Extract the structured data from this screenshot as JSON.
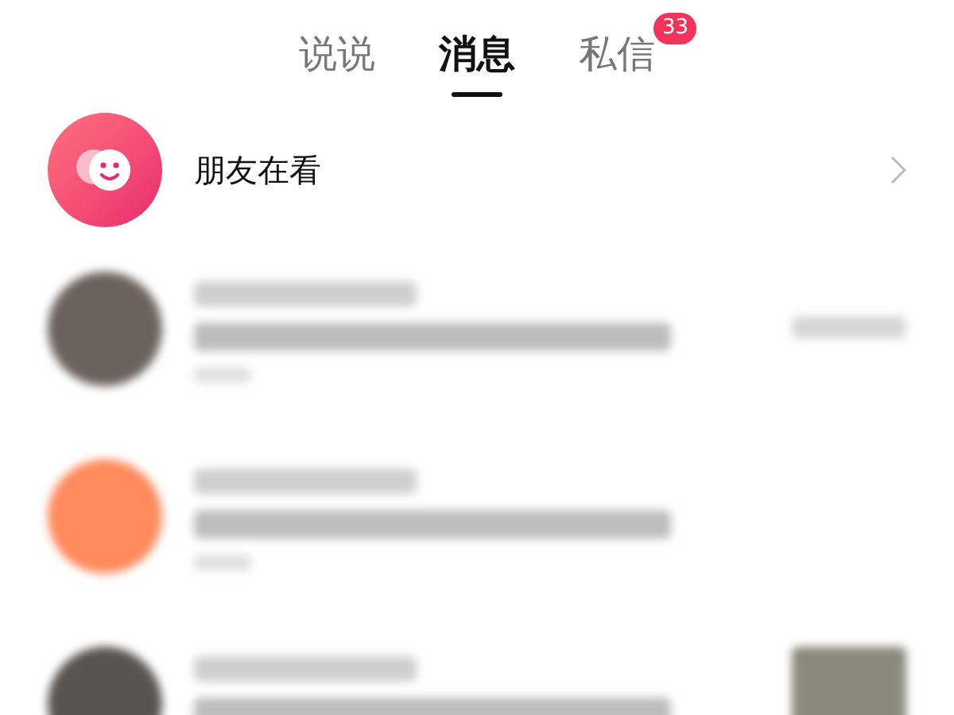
{
  "tabs": [
    {
      "label": "说说",
      "selected": false
    },
    {
      "label": "消息",
      "selected": true
    },
    {
      "label": "私信",
      "selected": false,
      "badge": "33"
    }
  ],
  "feature_row": {
    "label": "朋友在看"
  },
  "messages": [
    {
      "color": "#6b625e",
      "has_thumbnail": false,
      "has_side_text": true
    },
    {
      "color": "#ff8a5c",
      "has_thumbnail": false,
      "has_side_text": false
    },
    {
      "color": "#5a5450",
      "has_thumbnail": true,
      "has_side_text": false
    }
  ]
}
